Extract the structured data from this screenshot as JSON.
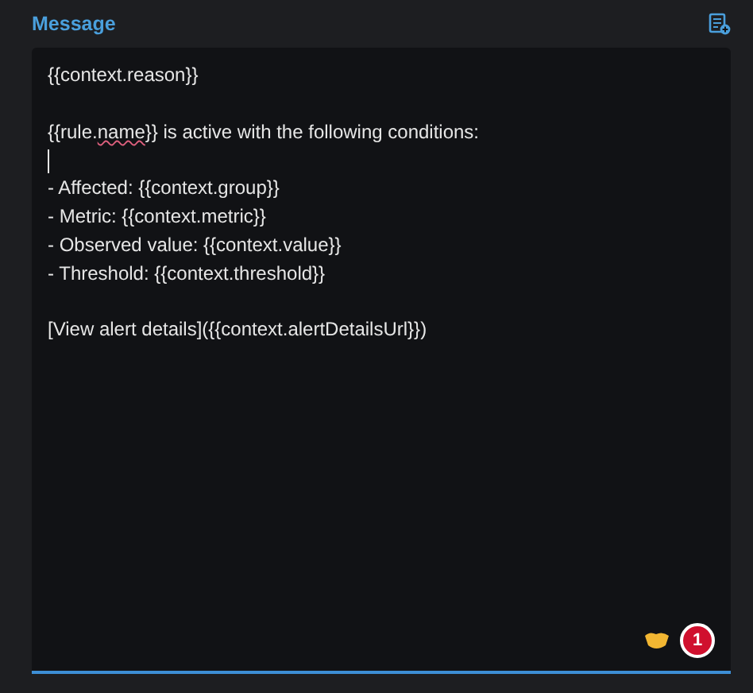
{
  "field": {
    "label": "Message",
    "lines": [
      {
        "kind": "text",
        "parts": [
          {
            "text": "{{context.reason}}",
            "misspelled": false
          }
        ]
      },
      {
        "kind": "blank"
      },
      {
        "kind": "text",
        "parts": [
          {
            "text": "{{rule.",
            "misspelled": false
          },
          {
            "text": "name",
            "misspelled": true
          },
          {
            "text": "}} is active with the following conditions:",
            "misspelled": false
          }
        ]
      },
      {
        "kind": "cursor"
      },
      {
        "kind": "text",
        "parts": [
          {
            "text": "- Affected: {{context.group}}",
            "misspelled": false
          }
        ]
      },
      {
        "kind": "text",
        "parts": [
          {
            "text": "- Metric: {{context.metric}}",
            "misspelled": false
          }
        ]
      },
      {
        "kind": "text",
        "parts": [
          {
            "text": "- Observed value: {{context.value}}",
            "misspelled": false
          }
        ]
      },
      {
        "kind": "text",
        "parts": [
          {
            "text": "- Threshold: {{context.threshold}}",
            "misspelled": false
          }
        ]
      },
      {
        "kind": "blank"
      },
      {
        "kind": "text",
        "parts": [
          {
            "text": "[View alert details]({{context.alertDetailsUrl}})",
            "misspelled": false
          }
        ]
      }
    ],
    "focused": true,
    "badge": "1"
  }
}
